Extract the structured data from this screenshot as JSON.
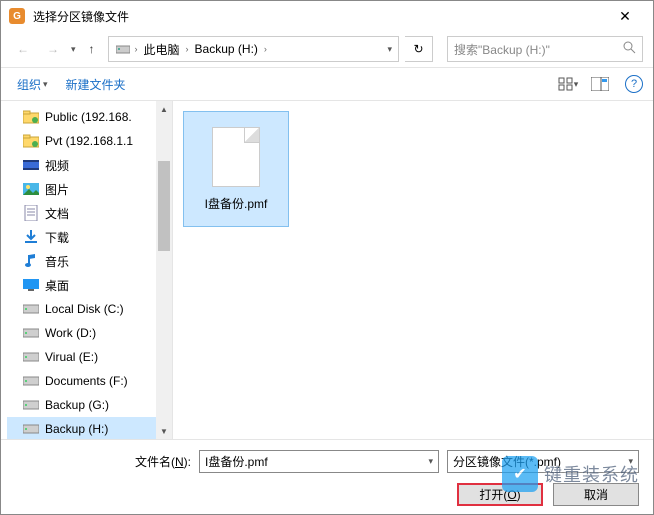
{
  "titlebar": {
    "title": "选择分区镜像文件"
  },
  "nav": {
    "crumb1": "此电脑",
    "crumb2": "Backup (H:)"
  },
  "search": {
    "placeholder": "搜索\"Backup (H:)\""
  },
  "toolbar": {
    "organize": "组织",
    "newfolder": "新建文件夹"
  },
  "tree": [
    {
      "icon": "folder-net",
      "label": "Public (192.168."
    },
    {
      "icon": "folder-net",
      "label": "Pvt (192.168.1.1"
    },
    {
      "icon": "video",
      "label": "视频"
    },
    {
      "icon": "picture",
      "label": "图片"
    },
    {
      "icon": "document",
      "label": "文档"
    },
    {
      "icon": "download",
      "label": "下载"
    },
    {
      "icon": "music",
      "label": "音乐"
    },
    {
      "icon": "desktop",
      "label": "桌面"
    },
    {
      "icon": "drive",
      "label": "Local Disk (C:)"
    },
    {
      "icon": "drive",
      "label": "Work (D:)"
    },
    {
      "icon": "drive",
      "label": "Virual (E:)"
    },
    {
      "icon": "drive",
      "label": "Documents (F:)"
    },
    {
      "icon": "drive",
      "label": "Backup (G:)"
    },
    {
      "icon": "drive",
      "label": "Backup (H:)",
      "selected": true
    }
  ],
  "file": {
    "name": "I盘备份.pmf"
  },
  "footer": {
    "filename_label_pre": "文件名(",
    "filename_label_u": "N",
    "filename_label_post": "):",
    "filename_value": "I盘备份.pmf",
    "filetype_value": "分区镜像文件(*.pmf)",
    "open_pre": "打开(",
    "open_u": "O",
    "open_post": ")",
    "cancel": "取消"
  },
  "watermark": {
    "text": "键重装系统"
  }
}
